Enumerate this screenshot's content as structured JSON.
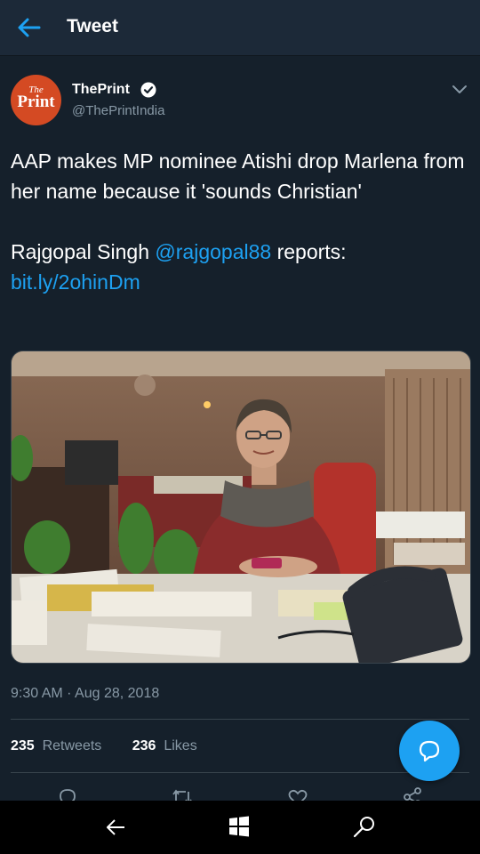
{
  "header": {
    "title": "Tweet"
  },
  "author": {
    "avatar_small": "The",
    "avatar_big": "Print",
    "name": "ThePrint",
    "handle": "@ThePrintIndia"
  },
  "tweet": {
    "line1": "AAP makes MP nominee Atishi drop Marlena from her name because it 'sounds Christian'",
    "line2_prefix": "Rajgopal Singh ",
    "mention": "@rajgopal88",
    "line2_suffix": " reports:",
    "link": "bit.ly/2ohinDm"
  },
  "meta": {
    "timestamp": "9:30 AM · Aug 28, 2018"
  },
  "stats": {
    "retweets_count": "235",
    "retweets_label": "Retweets",
    "likes_count": "236",
    "likes_label": "Likes"
  },
  "colors": {
    "background": "#15202b",
    "header": "#1c2938",
    "accent": "#1da1f2",
    "secondary_text": "#8899a6",
    "divider": "#38444d"
  },
  "icons": {
    "back": "back-arrow-icon",
    "verified": "verified-badge-icon",
    "chevron": "chevron-down-icon",
    "reply": "reply-icon",
    "retweet": "retweet-icon",
    "like": "heart-icon",
    "share": "share-icon",
    "compose": "compose-reply-icon",
    "nav_back": "nav-back-icon",
    "nav_home": "windows-logo-icon",
    "nav_search": "nav-search-icon"
  }
}
